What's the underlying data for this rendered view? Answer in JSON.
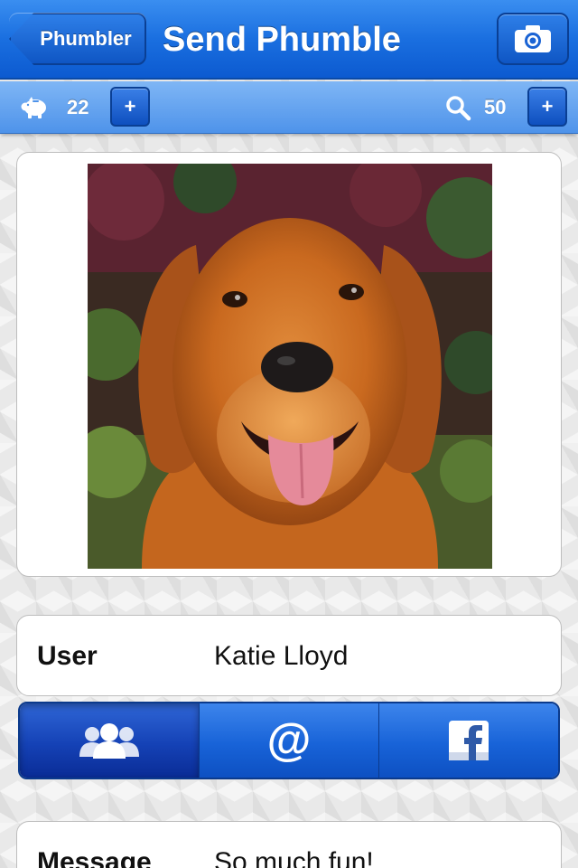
{
  "nav": {
    "back_label": "Phumbler",
    "title": "Send Phumble",
    "camera_icon": "camera-icon"
  },
  "toolbar": {
    "left": {
      "icon": "piggy-bank-icon",
      "count": "22",
      "add_label": "+"
    },
    "right": {
      "icon": "search-icon",
      "count": "50",
      "add_label": "+"
    }
  },
  "photo": {
    "subject": "golden retriever dog photo"
  },
  "user_field": {
    "label": "User",
    "value": "Katie Lloyd"
  },
  "share_options": {
    "selected": "contacts",
    "items": [
      {
        "id": "contacts",
        "icon": "contacts-icon"
      },
      {
        "id": "email",
        "icon": "at-sign-icon"
      },
      {
        "id": "facebook",
        "icon": "facebook-icon"
      }
    ]
  },
  "message_field": {
    "label": "Message",
    "value": "So much fun!"
  },
  "colors": {
    "nav_blue": "#1a6fe0",
    "toolbar_blue": "#4e93ea",
    "segment_active": "#1542b6"
  }
}
